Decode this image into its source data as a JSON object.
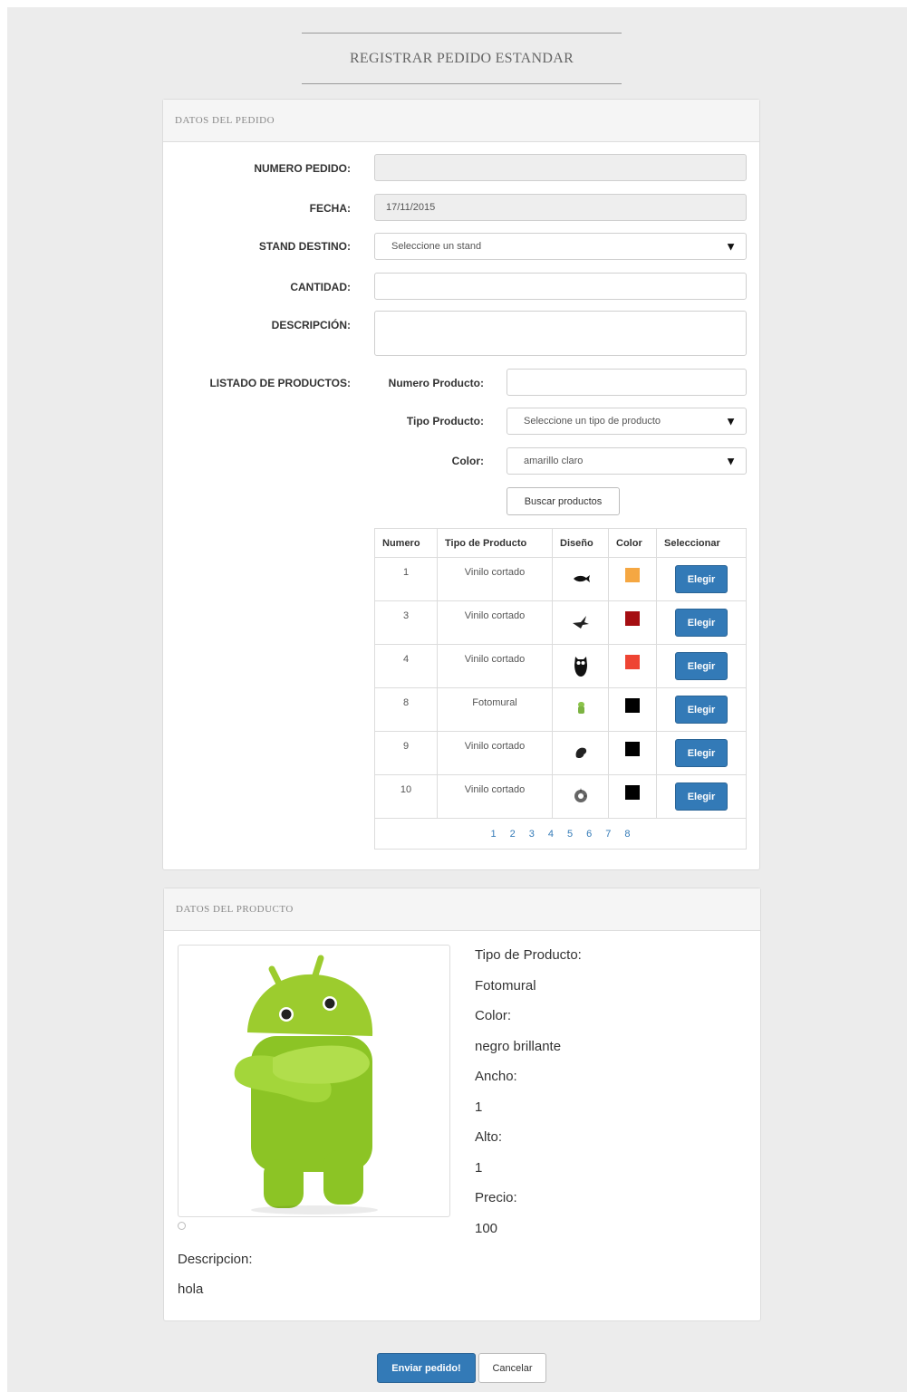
{
  "page": {
    "title": "REGISTRAR PEDIDO ESTANDAR"
  },
  "order_panel": {
    "heading": "DATOS DEL PEDIDO",
    "fields": {
      "numero": {
        "label": "NUMERO PEDIDO:",
        "value": ""
      },
      "fecha": {
        "label": "FECHA:",
        "value": "17/11/2015"
      },
      "stand": {
        "label": "STAND DESTINO:",
        "value": "Seleccione un stand"
      },
      "cantidad": {
        "label": "CANTIDAD:",
        "value": ""
      },
      "descripcion": {
        "label": "DESCRIPCIÓN:",
        "value": ""
      }
    },
    "product_list": {
      "label": "LISTADO DE PRODUCTOS:",
      "numero_label": "Numero Producto:",
      "numero_value": "",
      "tipo_label": "Tipo Producto:",
      "tipo_value": "Seleccione un tipo de producto",
      "color_label": "Color:",
      "color_value": "amarillo claro",
      "search_button": "Buscar productos"
    },
    "table": {
      "headers": [
        "Numero",
        "Tipo de Producto",
        "Diseño",
        "Color",
        "Seleccionar"
      ],
      "choose_label": "Elegir",
      "rows": [
        {
          "numero": "1",
          "tipo": "Vinilo cortado",
          "icon": "fish-silhouette-icon",
          "color": "#f5a742"
        },
        {
          "numero": "3",
          "tipo": "Vinilo cortado",
          "icon": "bird-silhouette-icon",
          "color": "#a50e12"
        },
        {
          "numero": "4",
          "tipo": "Vinilo cortado",
          "icon": "owl-silhouette-icon",
          "color": "#ee4433"
        },
        {
          "numero": "8",
          "tipo": "Fotomural",
          "icon": "android-icon",
          "color": "#000000"
        },
        {
          "numero": "9",
          "tipo": "Vinilo cortado",
          "icon": "swirl-silhouette-icon",
          "color": "#000000"
        },
        {
          "numero": "10",
          "tipo": "Vinilo cortado",
          "icon": "ornament-silhouette-icon",
          "color": "#000000"
        }
      ],
      "pages": [
        "1",
        "2",
        "3",
        "4",
        "5",
        "6",
        "7",
        "8"
      ]
    }
  },
  "product_panel": {
    "heading": "DATOS DEL PRODUCTO",
    "tipo_label": "Tipo de Producto:",
    "tipo_value": "Fotomural",
    "color_label": "Color:",
    "color_value": "negro brillante",
    "ancho_label": "Ancho:",
    "ancho_value": "1",
    "alto_label": "Alto:",
    "alto_value": "1",
    "precio_label": "Precio:",
    "precio_value": "100",
    "descripcion_label": "Descripcion:",
    "descripcion_value": "hola"
  },
  "actions": {
    "submit": "Enviar pedido!",
    "cancel": "Cancelar"
  },
  "colors": {
    "primary": "#337ab7",
    "android_green": "#9ccc2e"
  }
}
